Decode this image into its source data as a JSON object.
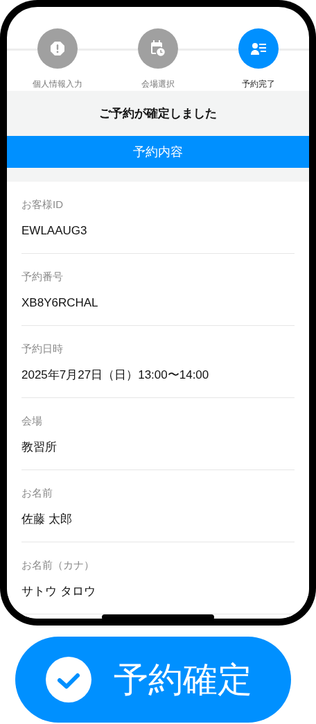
{
  "steps": [
    {
      "label": "個人情報入力",
      "selected": false
    },
    {
      "label": "会場選択",
      "selected": false
    },
    {
      "label": "予約完了",
      "selected": true
    }
  ],
  "message": "ご予約が確定しました",
  "section_title": "予約内容",
  "fields": [
    {
      "label": "お客様ID",
      "value": "EWLAAUG3"
    },
    {
      "label": "予約番号",
      "value": "XB8Y6RCHAL"
    },
    {
      "label": "予約日時",
      "value": "2025年7月27日（日）13:00〜14:00"
    },
    {
      "label": "会場",
      "value": "教習所"
    },
    {
      "label": "お名前",
      "value": "佐藤 太郎"
    },
    {
      "label": "お名前（カナ）",
      "value": "サトウ タロウ"
    }
  ],
  "confirm_button": {
    "label": "予約確定"
  }
}
